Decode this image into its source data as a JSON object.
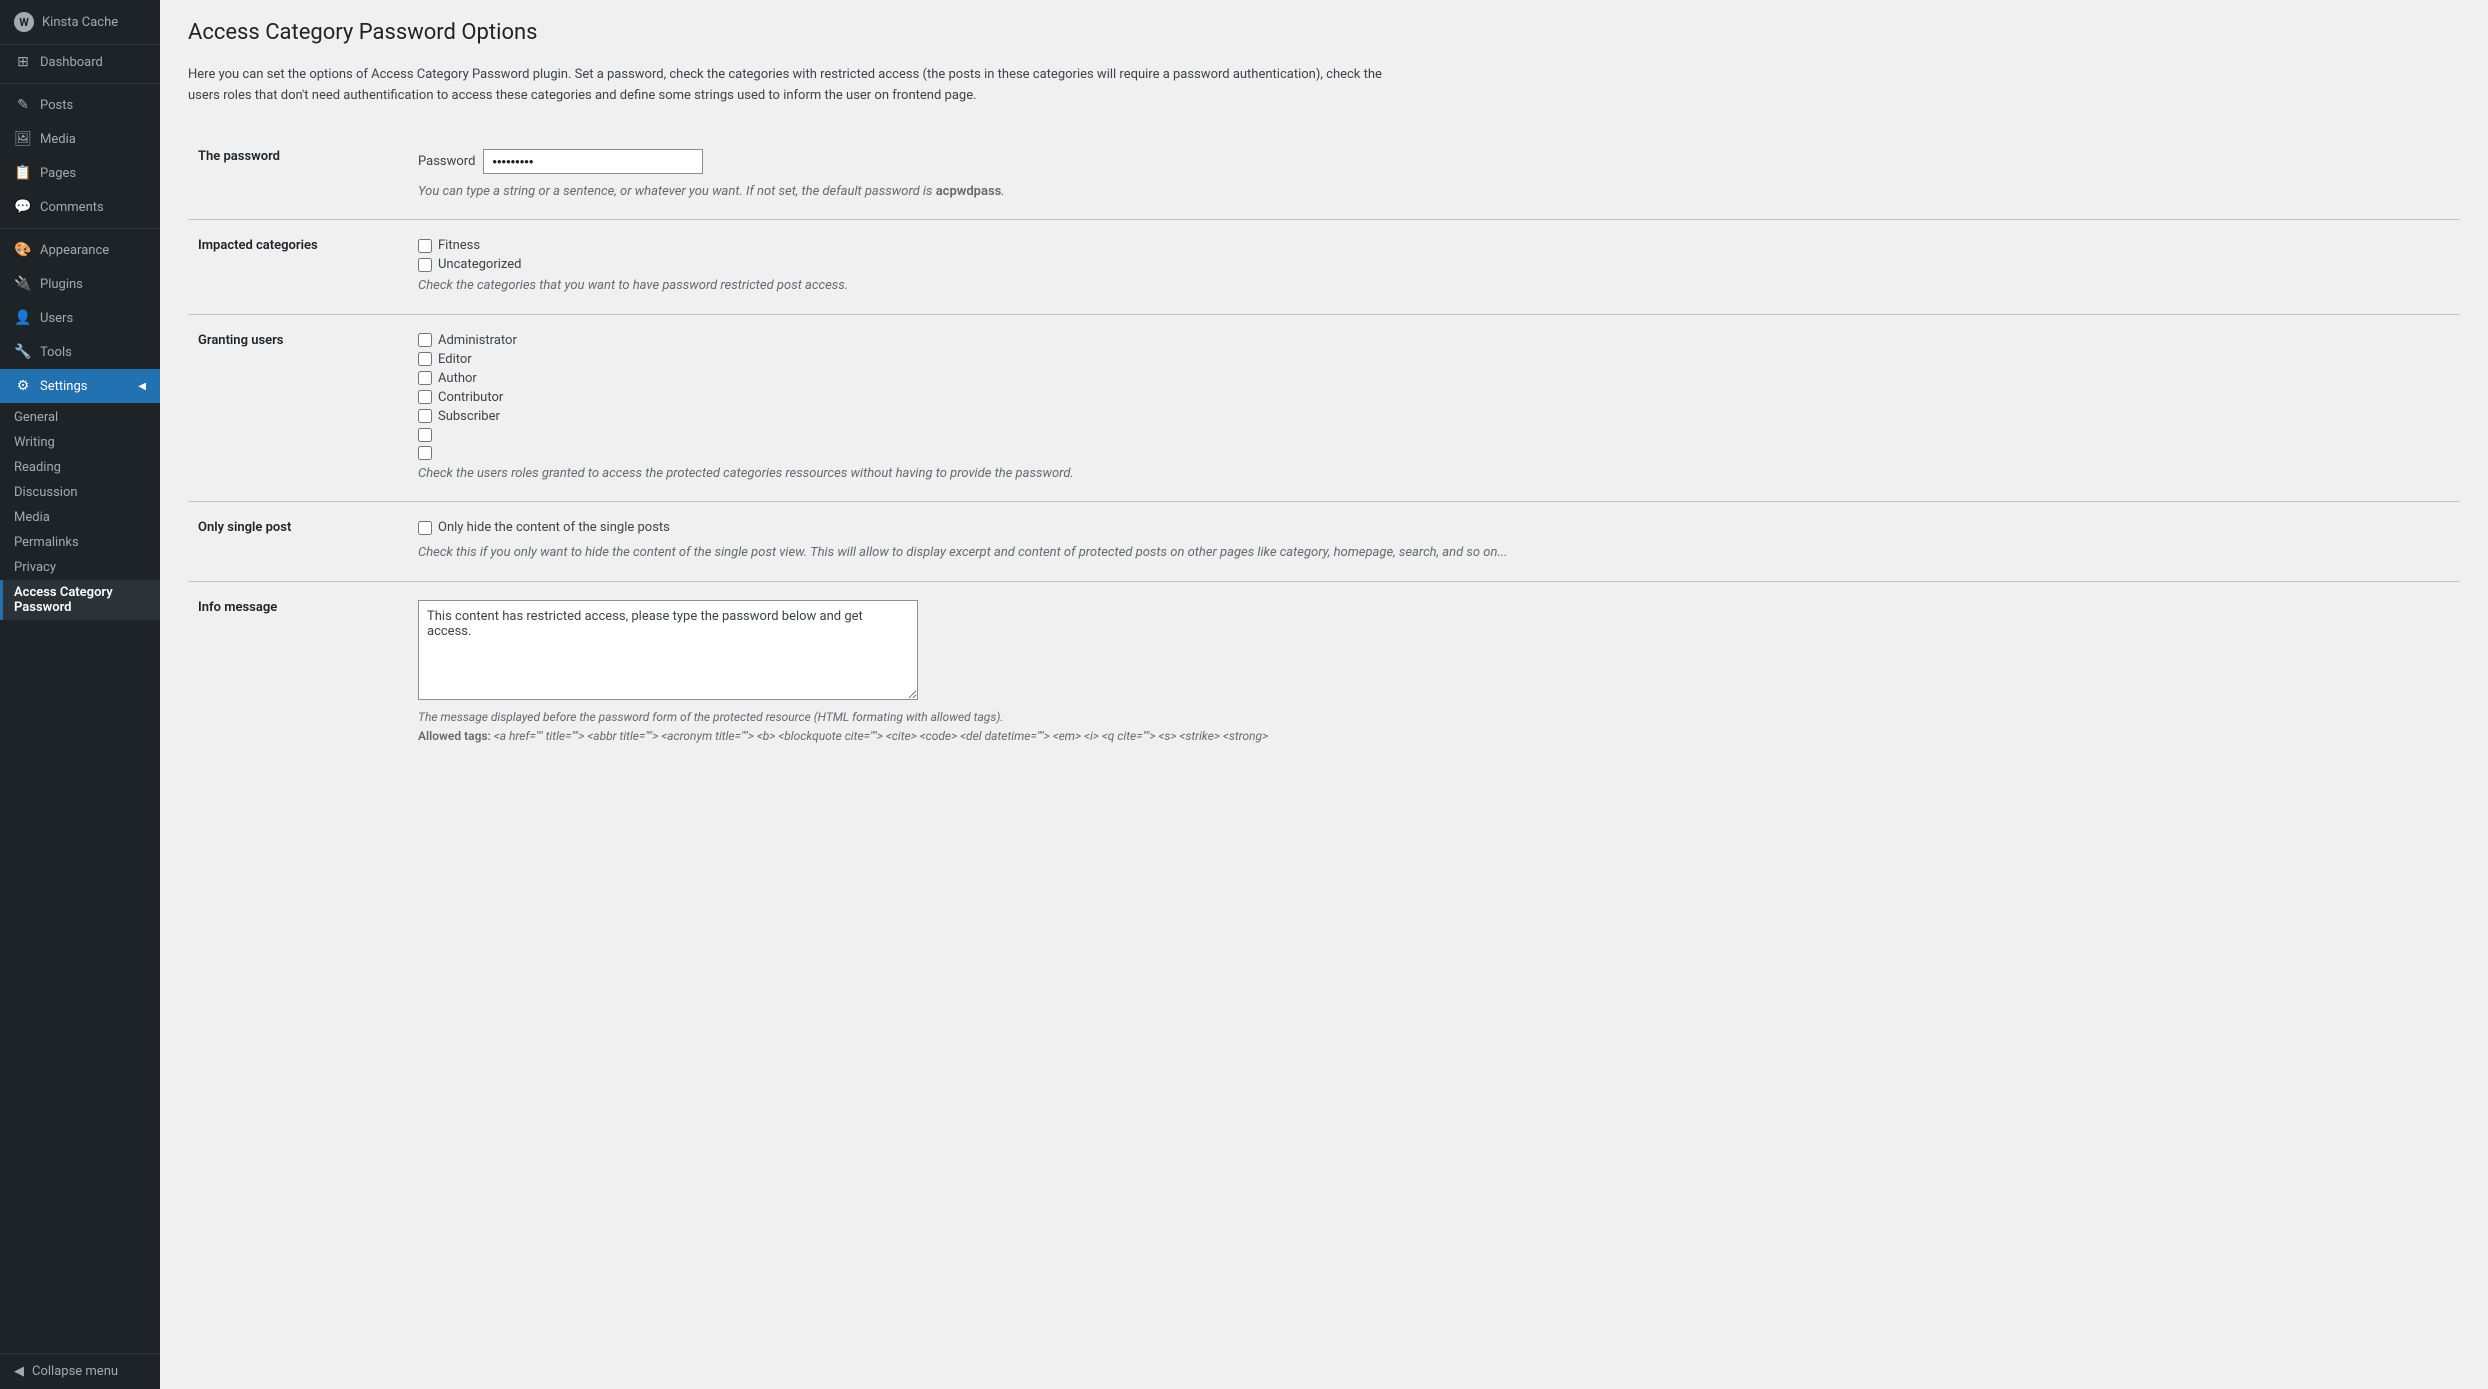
{
  "sidebar": {
    "logo_label": "Kinsta Cache",
    "items": [
      {
        "id": "dashboard",
        "label": "Dashboard",
        "icon": "⊞"
      },
      {
        "id": "posts",
        "label": "Posts",
        "icon": "📄"
      },
      {
        "id": "media",
        "label": "Media",
        "icon": "🖼"
      },
      {
        "id": "pages",
        "label": "Pages",
        "icon": "📋"
      },
      {
        "id": "comments",
        "label": "Comments",
        "icon": "💬"
      },
      {
        "id": "appearance",
        "label": "Appearance",
        "icon": "🎨"
      },
      {
        "id": "plugins",
        "label": "Plugins",
        "icon": "🔌"
      },
      {
        "id": "users",
        "label": "Users",
        "icon": "👤"
      },
      {
        "id": "tools",
        "label": "Tools",
        "icon": "🔧"
      },
      {
        "id": "settings",
        "label": "Settings",
        "icon": "⚙"
      }
    ],
    "settings_subnav": [
      {
        "id": "general",
        "label": "General"
      },
      {
        "id": "writing",
        "label": "Writing"
      },
      {
        "id": "reading",
        "label": "Reading"
      },
      {
        "id": "discussion",
        "label": "Discussion"
      },
      {
        "id": "media",
        "label": "Media"
      },
      {
        "id": "permalinks",
        "label": "Permalinks"
      },
      {
        "id": "privacy",
        "label": "Privacy"
      },
      {
        "id": "access-category-password",
        "label": "Access Category Password"
      }
    ],
    "collapse_label": "Collapse menu"
  },
  "main": {
    "page_title": "Access Category Password Options",
    "description": "Here you can set the options of Access Category Password plugin. Set a password, check the categories with restricted access (the posts in these categories will require a password authentication), check the users roles that don't need authentification to access these categories and define some strings used to inform the user on frontend page.",
    "sections": {
      "password": {
        "label": "The password",
        "field_label": "Password",
        "field_value": "••••••••••",
        "hint": "You can type a string or a sentence, or whatever you want. If not set, the default password is",
        "default_password": "acpwdpass"
      },
      "impacted_categories": {
        "label": "Impacted categories",
        "categories": [
          "Fitness",
          "Uncategorized"
        ],
        "hint": "Check the categories that you want to have password restricted post access."
      },
      "granting_users": {
        "label": "Granting users",
        "roles": [
          "Administrator",
          "Editor",
          "Author",
          "Contributor",
          "Subscriber",
          "",
          ""
        ],
        "hint": "Check the users roles granted to access the protected categories ressources without having to provide the password."
      },
      "only_single_post": {
        "label": "Only single post",
        "checkbox_label": "Only hide the content of the single posts",
        "hint": "Check this if you only want to hide the content of the single post view. This will allow to display excerpt and content of protected posts on other pages like category, homepage, search, and so on..."
      },
      "info_message": {
        "label": "Info message",
        "default_value": "This content has restricted access, please type the password below and get access.",
        "hint_line1": "The message displayed before the password form of the protected resource (HTML formating with allowed tags).",
        "hint_line2": "Allowed tags: <a href=\"\" title=\"\"> <abbr title=\"\"> <acronym title=\"\"> <b> <blockquote cite=\"\"> <cite> <code> <del datetime=\"\"> <em> <i> <q cite=\"\"> <s> <strike> <strong>"
      }
    }
  }
}
